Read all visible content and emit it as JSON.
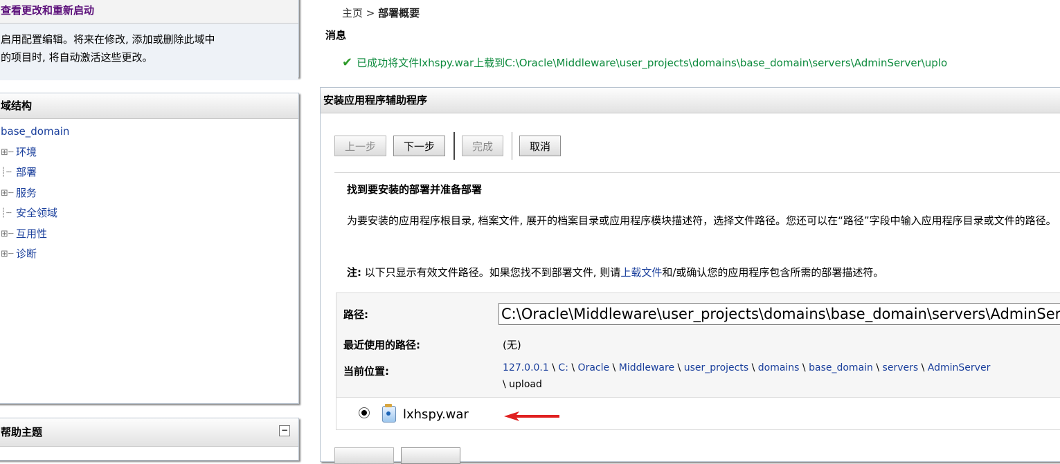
{
  "changes_panel": {
    "title": "查看更改和重新启动",
    "body_line1": "启用配置编辑。将来在修改, 添加或删除此域中",
    "body_line2": "的项目时, 将自动激活这些更改。"
  },
  "domain_tree": {
    "title": "域结构",
    "root": "base_domain",
    "items": [
      {
        "label": "环境",
        "expandable": true
      },
      {
        "label": "部署",
        "expandable": false
      },
      {
        "label": "服务",
        "expandable": true
      },
      {
        "label": "安全领域",
        "expandable": false
      },
      {
        "label": "互用性",
        "expandable": true
      },
      {
        "label": "诊断",
        "expandable": true
      }
    ]
  },
  "help_panel": {
    "title": "帮助主题"
  },
  "breadcrumb": {
    "home": "主页 >",
    "current": "部署概要"
  },
  "messages": {
    "title": "消息",
    "success": "已成功将文件lxhspy.war上载到C:\\Oracle\\Middleware\\user_projects\\domains\\base_domain\\servers\\AdminServer\\uplo"
  },
  "wizard": {
    "title": "安装应用程序辅助程序",
    "buttons": {
      "back": "上一步",
      "next": "下一步",
      "finish": "完成",
      "cancel": "取消"
    },
    "section_title": "找到要安装的部署并准备部署",
    "description": "为要安装的应用程序根目录, 档案文件, 展开的档案目录或应用程序模块描述符，选择文件路径。您还可以在“路径”字段中输入应用程序目录或文件的路径。",
    "note_label": "注:",
    "note_before": " 以下只显示有效文件路径。如果您找不到部署文件, 则请",
    "note_link": "上载文件",
    "note_after": "和/或确认您的应用程序包含所需的部署描述符。",
    "path_label": "路径:",
    "path_value": "C:\\Oracle\\Middleware\\user_projects\\domains\\base_domain\\servers\\AdminServer\\upload",
    "recent_label": "最近使用的路径:",
    "recent_value": "(无)",
    "location_label": "当前位置:",
    "location_crumbs": [
      "127.0.0.1",
      "C:",
      "Oracle",
      "Middleware",
      "user_projects",
      "domains",
      "base_domain",
      "servers",
      "AdminServer"
    ],
    "location_last": "\\ upload",
    "file_name": "lxhspy.war"
  },
  "colors": {
    "link": "#1a3f9c",
    "success": "#0c8a3c",
    "arrow": "#e02020"
  }
}
